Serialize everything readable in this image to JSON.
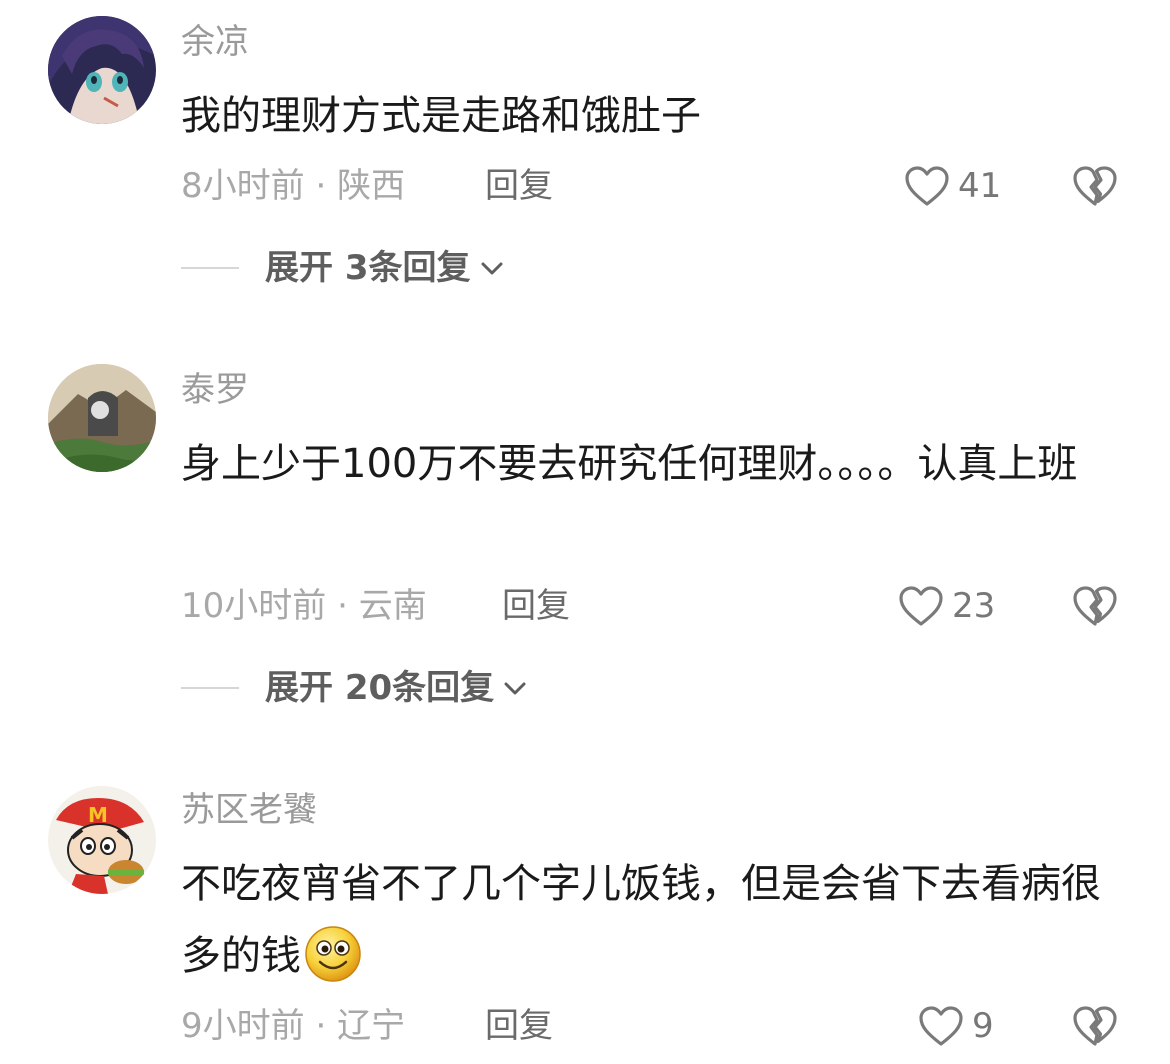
{
  "comments": [
    {
      "username": "余凉",
      "text": "我的理财方式是走路和饿肚子",
      "time": "8小时前",
      "location": "陕西",
      "reply_label": "回复",
      "likes": "41",
      "expand_label": "展开 3条回复"
    },
    {
      "username": "泰罗",
      "text": "身上少于100万不要去研究任何理财。。。。认真上班",
      "time": "10小时前",
      "location": "云南",
      "reply_label": "回复",
      "likes": "23",
      "expand_label": "展开 20条回复"
    },
    {
      "username": "苏区老饕",
      "text": "不吃夜宵省不了几个字儿饭钱，但是会省下去看病很多的钱",
      "time": "9小时前",
      "location": "辽宁",
      "reply_label": "回复",
      "likes": "9"
    }
  ],
  "meta_separator": " · ",
  "icons": {
    "like": "heart-outline-icon",
    "dislike": "broken-heart-icon",
    "expand": "chevron-down-icon",
    "emoji": "smiling-face-emoji"
  },
  "colors": {
    "username": "#9a9a9a",
    "text": "#1a1a1a",
    "meta": "#a8a8a8",
    "reply": "#6a6a6a",
    "expand": "#5e5e5e"
  }
}
